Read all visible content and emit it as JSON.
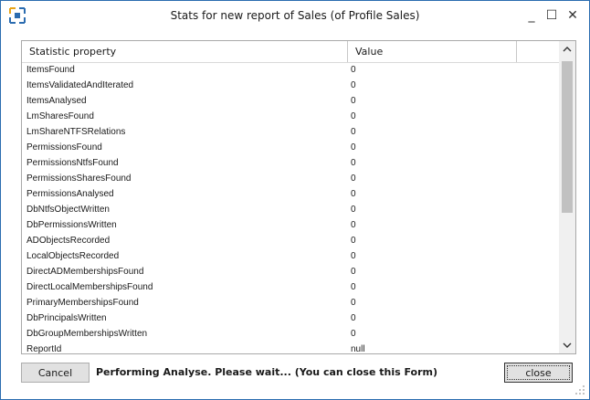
{
  "window": {
    "title": "Stats for new report of Sales (of Profile Sales)",
    "minimize_glyph": "_",
    "maximize_glyph": "☐",
    "close_glyph": "✕",
    "accent_color": "#2b6cb0"
  },
  "grid": {
    "columns": [
      "Statistic property",
      "Value"
    ],
    "rows": [
      {
        "property": "ItemsFound",
        "value": "0"
      },
      {
        "property": "ItemsValidatedAndIterated",
        "value": "0"
      },
      {
        "property": "ItemsAnalysed",
        "value": "0"
      },
      {
        "property": "LmSharesFound",
        "value": "0"
      },
      {
        "property": "LmShareNTFSRelations",
        "value": "0"
      },
      {
        "property": "PermissionsFound",
        "value": "0"
      },
      {
        "property": "PermissionsNtfsFound",
        "value": "0"
      },
      {
        "property": "PermissionsSharesFound",
        "value": "0"
      },
      {
        "property": "PermissionsAnalysed",
        "value": "0"
      },
      {
        "property": "DbNtfsObjectWritten",
        "value": "0"
      },
      {
        "property": "DbPermissionsWritten",
        "value": "0"
      },
      {
        "property": "ADObjectsRecorded",
        "value": "0"
      },
      {
        "property": "LocalObjectsRecorded",
        "value": "0"
      },
      {
        "property": "DirectADMembershipsFound",
        "value": "0"
      },
      {
        "property": "DirectLocalMembershipsFound",
        "value": "0"
      },
      {
        "property": "PrimaryMembershipsFound",
        "value": "0"
      },
      {
        "property": "DbPrincipalsWritten",
        "value": "0"
      },
      {
        "property": "DbGroupMembershipsWritten",
        "value": "0"
      },
      {
        "property": "ReportId",
        "value": "null"
      }
    ]
  },
  "footer": {
    "cancel_label": "Cancel",
    "status_text": "Performing Analyse. Please wait... (You can close this Form)",
    "close_label": "close"
  }
}
